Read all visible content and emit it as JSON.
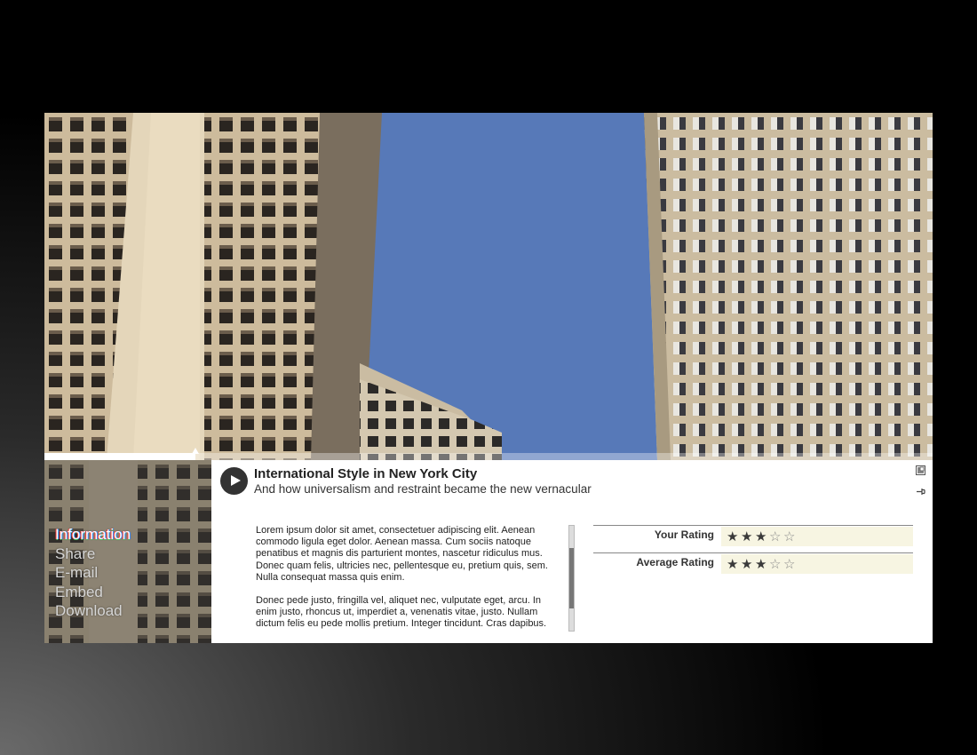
{
  "video": {
    "title": "International Style in New York City",
    "subtitle": "And how universalism and restraint became the new vernacular",
    "progress": 0.17
  },
  "nav": {
    "items": [
      {
        "label": "Information",
        "active": true
      },
      {
        "label": "Share",
        "active": false
      },
      {
        "label": "E-mail",
        "active": false
      },
      {
        "label": "Embed",
        "active": false
      },
      {
        "label": "Download",
        "active": false
      }
    ]
  },
  "description": {
    "paragraphs": [
      "Lorem ipsum dolor sit amet, consectetuer adipiscing elit. Aenean commodo ligula eget dolor. Aenean massa. Cum sociis natoque penatibus et magnis dis parturient montes, nascetur ridiculus mus. Donec quam felis, ultricies nec, pellentesque eu, pretium quis, sem. Nulla consequat massa quis enim.",
      "Donec pede justo, fringilla vel, aliquet nec, vulputate eget, arcu. In enim justo, rhoncus ut, imperdiet a, venenatis vitae, justo. Nullam dictum felis eu pede mollis pretium. Integer tincidunt. Cras dapibus."
    ]
  },
  "ratings": {
    "your": {
      "label": "Your Rating",
      "value": 3,
      "max": 5
    },
    "average": {
      "label": "Average Rating",
      "value": 3,
      "max": 5
    }
  },
  "icons": {
    "play": "play-icon",
    "popout": "popout-icon",
    "pin": "pin-icon",
    "star": "star-icon"
  },
  "colors": {
    "sky": "#5779b8",
    "concrete": "#d6c6a8",
    "rating_bg": "#f7f5e2",
    "panel_bg": "#ffffff"
  }
}
